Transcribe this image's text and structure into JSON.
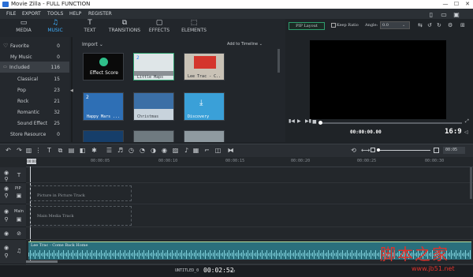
{
  "app": {
    "title": "Movie Zilla - FULL FUNCTION"
  },
  "menu": [
    "FILE",
    "EXPORT",
    "TOOLS",
    "HELP",
    "REGISTER"
  ],
  "tabs": [
    {
      "label": "MEDIA",
      "icon": "folder-icon"
    },
    {
      "label": "MUSIC",
      "icon": "music-icon",
      "active": true
    },
    {
      "label": "TEXT",
      "icon": "text-icon"
    },
    {
      "label": "TRANSITIONS",
      "icon": "transitions-icon"
    },
    {
      "label": "EFFECTS",
      "icon": "effects-icon"
    },
    {
      "label": "ELEMENTS",
      "icon": "elements-icon"
    }
  ],
  "sidebar": [
    {
      "label": "Favorite",
      "count": "0"
    },
    {
      "label": "My Music",
      "count": "0"
    },
    {
      "label": "Included",
      "count": "116"
    },
    {
      "label": "Classical",
      "count": "15"
    },
    {
      "label": "Pop",
      "count": "23"
    },
    {
      "label": "Rock",
      "count": "21"
    },
    {
      "label": "Romantic",
      "count": "32"
    },
    {
      "label": "Sound Effect",
      "count": "25"
    },
    {
      "label": "Store Resource",
      "count": "0"
    }
  ],
  "media": {
    "import_label": "Import",
    "add_label": "Add to Timeline",
    "thumbs": [
      {
        "caption": "Effect Score",
        "num": ""
      },
      {
        "caption": "Little Maps",
        "num": "2"
      },
      {
        "caption": "Lee Trac - C..",
        "num": ""
      },
      {
        "caption": "Happy Mars ...",
        "num": "2"
      },
      {
        "caption": "Christmas",
        "num": ""
      },
      {
        "caption": "Discovery",
        "num": ""
      }
    ]
  },
  "preview": {
    "pip_label": "PIP Layout",
    "keep_ratio": "Keep Ratio",
    "angle_label": "Angle:",
    "angle_value": "0.0",
    "time_display": "00:00:00.00",
    "ratio": "16:9"
  },
  "timeline": {
    "ticks": [
      "00:00:05",
      "00:00:10",
      "00:00:15",
      "00:00:20",
      "00:00:25",
      "00:00:30"
    ],
    "start_tick": "00:00",
    "zoom_value": "00:05",
    "pip_track_label": "PIP",
    "main_track_label": "Main",
    "pip_placeholder": "Picture in Picture Track",
    "main_placeholder": "Main Media Track",
    "audio_clip": "Lee Trac - Come Back Home"
  },
  "status": {
    "project": "UNTITLED_0",
    "time": "00:02:52"
  },
  "watermark": {
    "cn": "脚本之家",
    "url": "www.jb51.net"
  },
  "colors": {
    "accent": "#3fb0ff",
    "audio": "#5ab8c9",
    "frame": "#2f9e6e"
  }
}
